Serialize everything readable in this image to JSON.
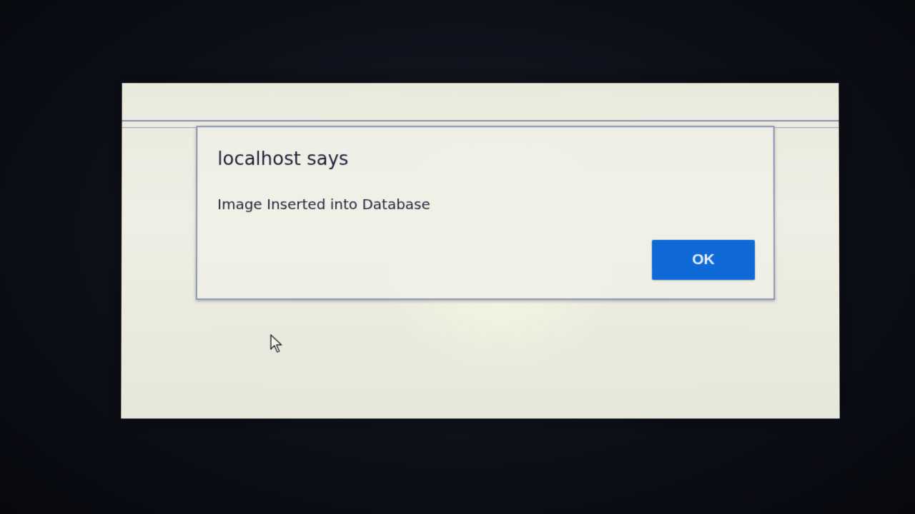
{
  "dialog": {
    "title": "localhost says",
    "message": "Image Inserted into Database",
    "ok_label": "OK"
  },
  "colors": {
    "button_blue": "#0f6ad8",
    "screen_bg": "#eeeee4",
    "bezel": "#0d1018",
    "text": "#1d2036"
  },
  "icons": {
    "cursor": "mouse-pointer-icon"
  }
}
